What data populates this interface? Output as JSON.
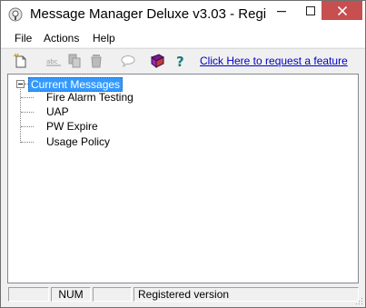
{
  "window": {
    "title": "Message Manager Deluxe v3.03 - Regi",
    "controls": {
      "minimize": "minimize-icon",
      "maximize": "maximize-icon",
      "close": "close-icon"
    }
  },
  "menu": {
    "items": [
      {
        "label": "File"
      },
      {
        "label": "Actions"
      },
      {
        "label": "Help"
      }
    ]
  },
  "toolbar": {
    "icons": [
      "new-message-icon",
      "rename-icon",
      "copy-icon",
      "delete-icon",
      "comment-icon",
      "book-icon",
      "help-icon"
    ],
    "link_text": "Click Here to request a feature"
  },
  "tree": {
    "root": {
      "label": "Current Messages",
      "expanded": true,
      "selected": true
    },
    "children": [
      {
        "label": "Fire Alarm Testing"
      },
      {
        "label": "UAP"
      },
      {
        "label": "PW Expire"
      },
      {
        "label": "Usage Policy"
      }
    ]
  },
  "statusbar": {
    "panes": [
      "",
      "NUM",
      "",
      "Registered version"
    ]
  },
  "colors": {
    "selection": "#3399ff",
    "close_button": "#c74f50",
    "link": "#0000cc"
  }
}
